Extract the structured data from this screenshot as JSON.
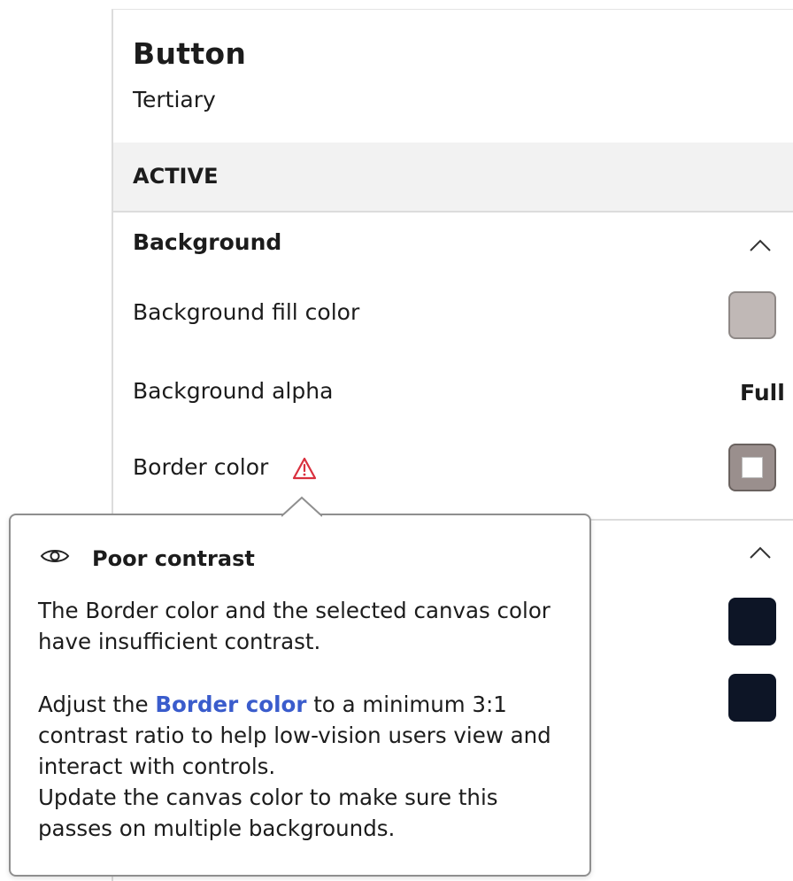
{
  "panel": {
    "title": "Button",
    "subtitle": "Tertiary",
    "state_label": "ACTIVE",
    "section_title": "Background",
    "rows": {
      "fill_color_label": "Background fill color",
      "alpha_label": "Background alpha",
      "alpha_value": "Full",
      "border_color_label": "Border color"
    }
  },
  "colors": {
    "fill_swatch": "#c0b8b6",
    "border_swatch": "#9a8f8d",
    "dark_swatch": "#0d1526",
    "warning": "#d9303e",
    "link": "#3a5ccc"
  },
  "tooltip": {
    "icon": "eye-icon",
    "title": "Poor contrast",
    "paragraph1": "The Border color and the selected canvas color have insufficient contrast.",
    "paragraph2_prefix": "Adjust the ",
    "paragraph2_link": "Border color",
    "paragraph2_suffix": " to a minimum 3:1 contrast ratio to help low-vision users view and interact with controls.",
    "paragraph3": "Update the canvas color to make sure this passes on multiple backgrounds."
  }
}
